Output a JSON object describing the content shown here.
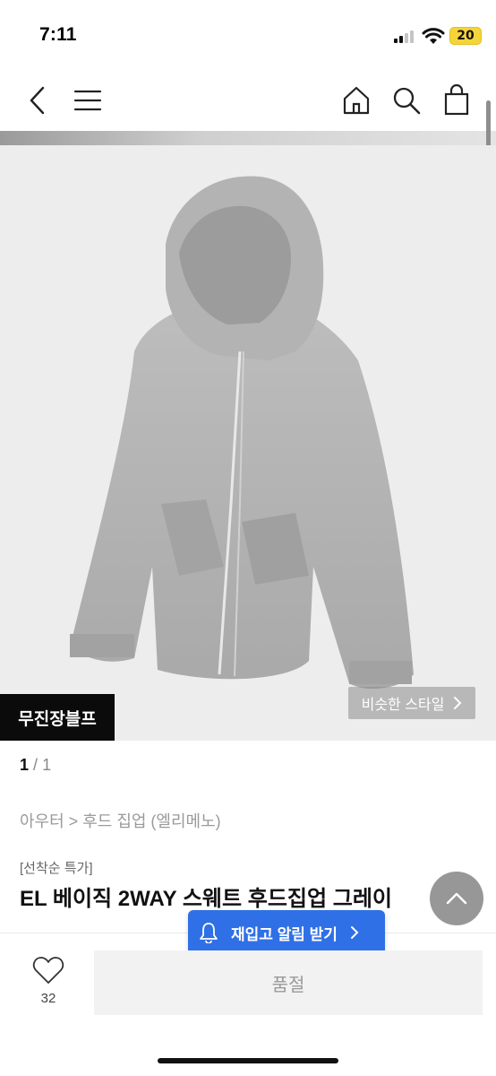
{
  "status_bar": {
    "time": "7:11",
    "battery": "20"
  },
  "nav": {
    "back_icon": "chevron-left-icon",
    "menu_icon": "hamburger-icon",
    "home_icon": "home-icon",
    "search_icon": "search-icon",
    "cart_icon": "shopping-bag-icon"
  },
  "product_image": {
    "brand_badge": "무진장블프",
    "similar_style": "비슷한 스타일",
    "page_current": "1",
    "page_separator": "/",
    "page_total": "1"
  },
  "breadcrumb": "아우터 > 후드 집업 (엘리메노)",
  "product": {
    "promo_tag": "[선착순 특가]",
    "title": "EL 베이직 2WAY 스웨트 후드집업 그레이"
  },
  "bottom": {
    "restock_label": "재입고 알림 받기",
    "like_count": "32",
    "soldout_label": "품절"
  },
  "colors": {
    "accent": "#2f70e6",
    "badge": "#0b0b0b",
    "soldout_bg": "#f2f2f2"
  }
}
